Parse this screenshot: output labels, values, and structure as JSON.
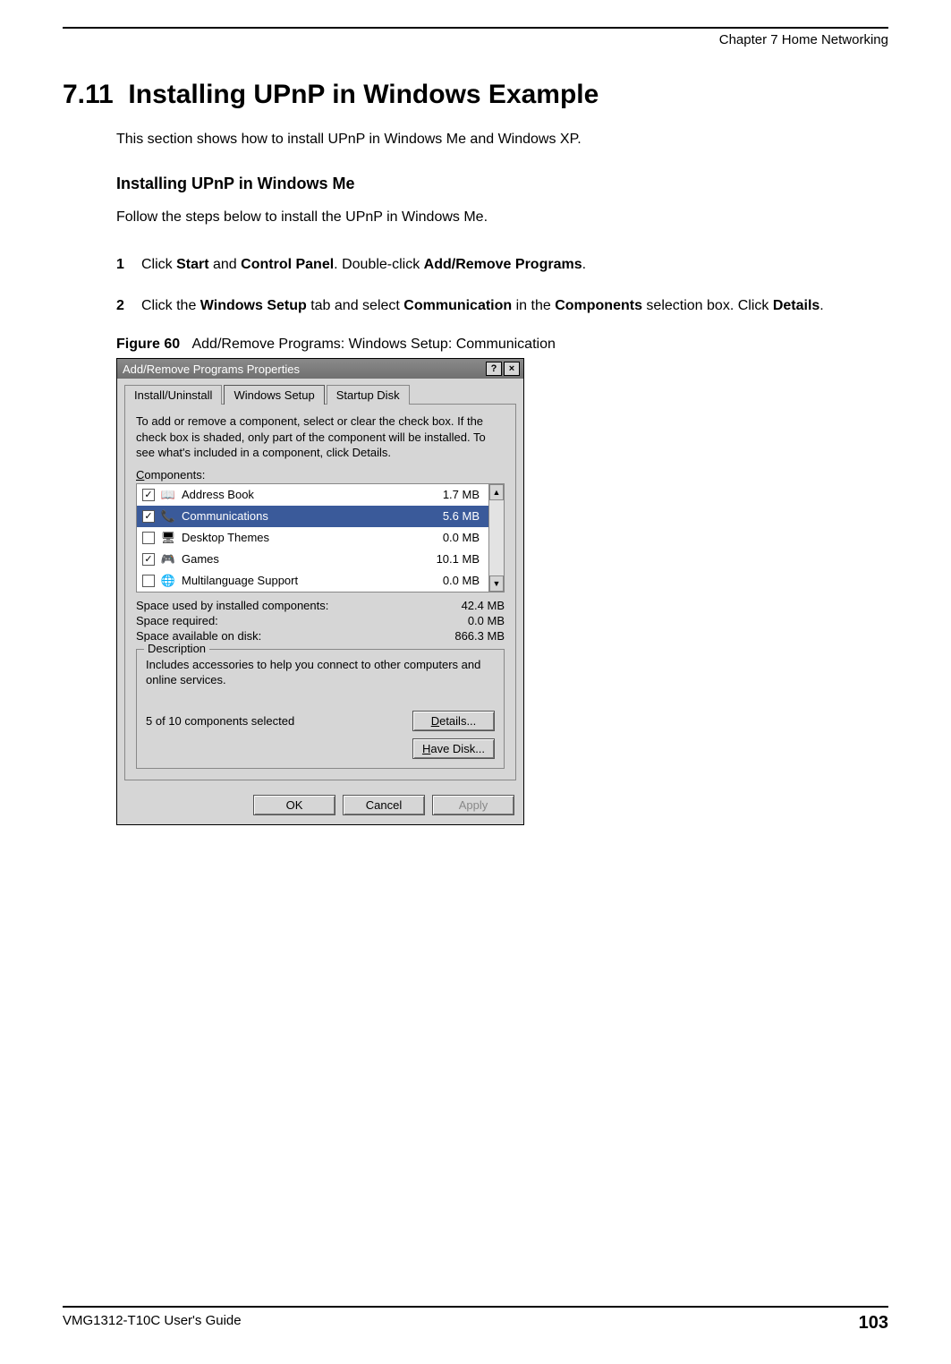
{
  "header": {
    "chapter": "Chapter 7 Home Networking"
  },
  "section": {
    "number": "7.11",
    "title": "Installing UPnP in Windows Example",
    "intro": "This section shows how to install UPnP in Windows Me and Windows XP."
  },
  "subsection": {
    "title": "Installing UPnP in Windows Me",
    "intro": "Follow the steps below to install the UPnP in Windows Me."
  },
  "steps": [
    {
      "num": "1",
      "prefix": "Click ",
      "b1": "Start",
      "mid1": " and ",
      "b2": "Control Panel",
      "mid2": ". Double-click ",
      "b3": "Add/Remove Programs",
      "suffix": "."
    },
    {
      "num": "2",
      "prefix": "Click the ",
      "b1": "Windows Setup",
      "mid1": " tab and select ",
      "b2": "Communication",
      "mid2": " in the ",
      "b3": "Components",
      "mid3": " selection box. Click ",
      "b4": "Details",
      "suffix": "."
    }
  ],
  "figure": {
    "label": "Figure 60",
    "caption": "Add/Remove Programs: Windows Setup: Communication"
  },
  "dialog": {
    "title": "Add/Remove Programs Properties",
    "help_btn": "?",
    "close_btn": "×",
    "tabs": [
      "Install/Uninstall",
      "Windows Setup",
      "Startup Disk"
    ],
    "active_tab_index": 1,
    "instructions": "To add or remove a component, select or clear the check box. If the check box is shaded, only part of the component will be installed. To see what's included in a component, click Details.",
    "components_label": "Components:",
    "components": [
      {
        "checked": true,
        "icon": "📖",
        "name": "Address Book",
        "size": "1.7 MB",
        "selected": false
      },
      {
        "checked": true,
        "icon": "📞",
        "name": "Communications",
        "size": "5.6 MB",
        "selected": true
      },
      {
        "checked": false,
        "icon": "🖥",
        "name": "Desktop Themes",
        "size": "0.0 MB",
        "selected": false
      },
      {
        "checked": true,
        "icon": "🎮",
        "name": "Games",
        "size": "10.1 MB",
        "selected": false
      },
      {
        "checked": false,
        "icon": "🌐",
        "name": "Multilanguage Support",
        "size": "0.0 MB",
        "selected": false
      }
    ],
    "stats": [
      {
        "label": "Space used by installed components:",
        "value": "42.4 MB"
      },
      {
        "label": "Space required:",
        "value": "0.0 MB"
      },
      {
        "label": "Space available on disk:",
        "value": "866.3 MB"
      }
    ],
    "description_legend": "Description",
    "description_text": "Includes accessories to help you connect to other computers and online services.",
    "components_selected": "5 of 10 components selected",
    "details_btn": "Details...",
    "have_disk_btn": "Have Disk...",
    "ok_btn": "OK",
    "cancel_btn": "Cancel",
    "apply_btn": "Apply"
  },
  "footer": {
    "guide": "VMG1312-T10C User's Guide",
    "page": "103"
  }
}
